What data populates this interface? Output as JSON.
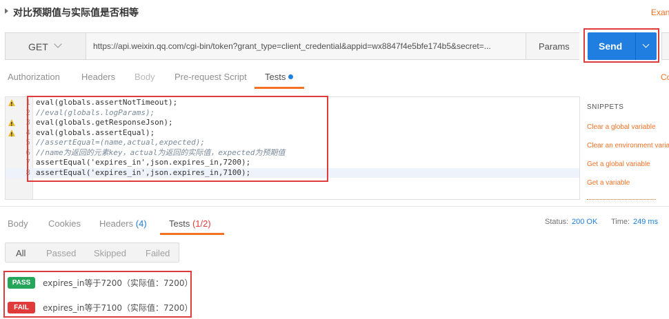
{
  "header": {
    "title": "对比预期值与实际值是否相等",
    "examples_link": "Exan"
  },
  "request": {
    "method": "GET",
    "url": "https://api.weixin.qq.com/cgi-bin/token?grant_type=client_credential&appid=wx8847f4e5bfe174b5&secret=...",
    "params_label": "Params",
    "send_label": "Send"
  },
  "request_tabs": {
    "authorization": "Authorization",
    "headers": "Headers",
    "body": "Body",
    "prerequest": "Pre-request Script",
    "tests": "Tests",
    "right_link": "Co"
  },
  "editor": {
    "lines": [
      {
        "num": "1",
        "warn": true,
        "text": "eval(globals.assertNotTimeout);"
      },
      {
        "num": "2",
        "warn": false,
        "text": "//eval(globals.logParams);"
      },
      {
        "num": "3",
        "warn": true,
        "text": "eval(globals.getResponseJson);"
      },
      {
        "num": "4",
        "warn": true,
        "text": "eval(globals.assertEqual);"
      },
      {
        "num": "5",
        "warn": false,
        "text": "//assertEqual=(name,actual,expected);"
      },
      {
        "num": "6",
        "warn": false,
        "text": "//name为返回的元素key，actual为返回的实际值，expected为预期值"
      },
      {
        "num": "7",
        "warn": false,
        "text": "assertEqual('expires_in',json.expires_in,7200);"
      },
      {
        "num": "8",
        "warn": false,
        "text": "assertEqual('expires_in',json.expires_in,7100);"
      }
    ]
  },
  "snippets": {
    "heading": "SNIPPETS",
    "items": [
      "Clear a global variable",
      "Clear an environment varia",
      "Get a global variable",
      "Get a variable"
    ]
  },
  "response_tabs": {
    "body": "Body",
    "cookies": "Cookies",
    "headers": "Headers",
    "headers_count": "(4)",
    "tests": "Tests",
    "tests_count": "(1/2)"
  },
  "status": {
    "status_label": "Status:",
    "status_value": "200 OK",
    "time_label": "Time:",
    "time_value": "249 ms"
  },
  "filters": {
    "all": "All",
    "passed": "Passed",
    "skipped": "Skipped",
    "failed": "Failed"
  },
  "results": [
    {
      "status": "PASS",
      "text": "expires_in等于7200（实际值：7200）"
    },
    {
      "status": "FAIL",
      "text": "expires_in等于7100（实际值：7200）"
    }
  ],
  "colors": {
    "accent": "#f47023",
    "primary": "#1f7ee0",
    "pass": "#26a65b",
    "fail": "#e03a3a"
  }
}
